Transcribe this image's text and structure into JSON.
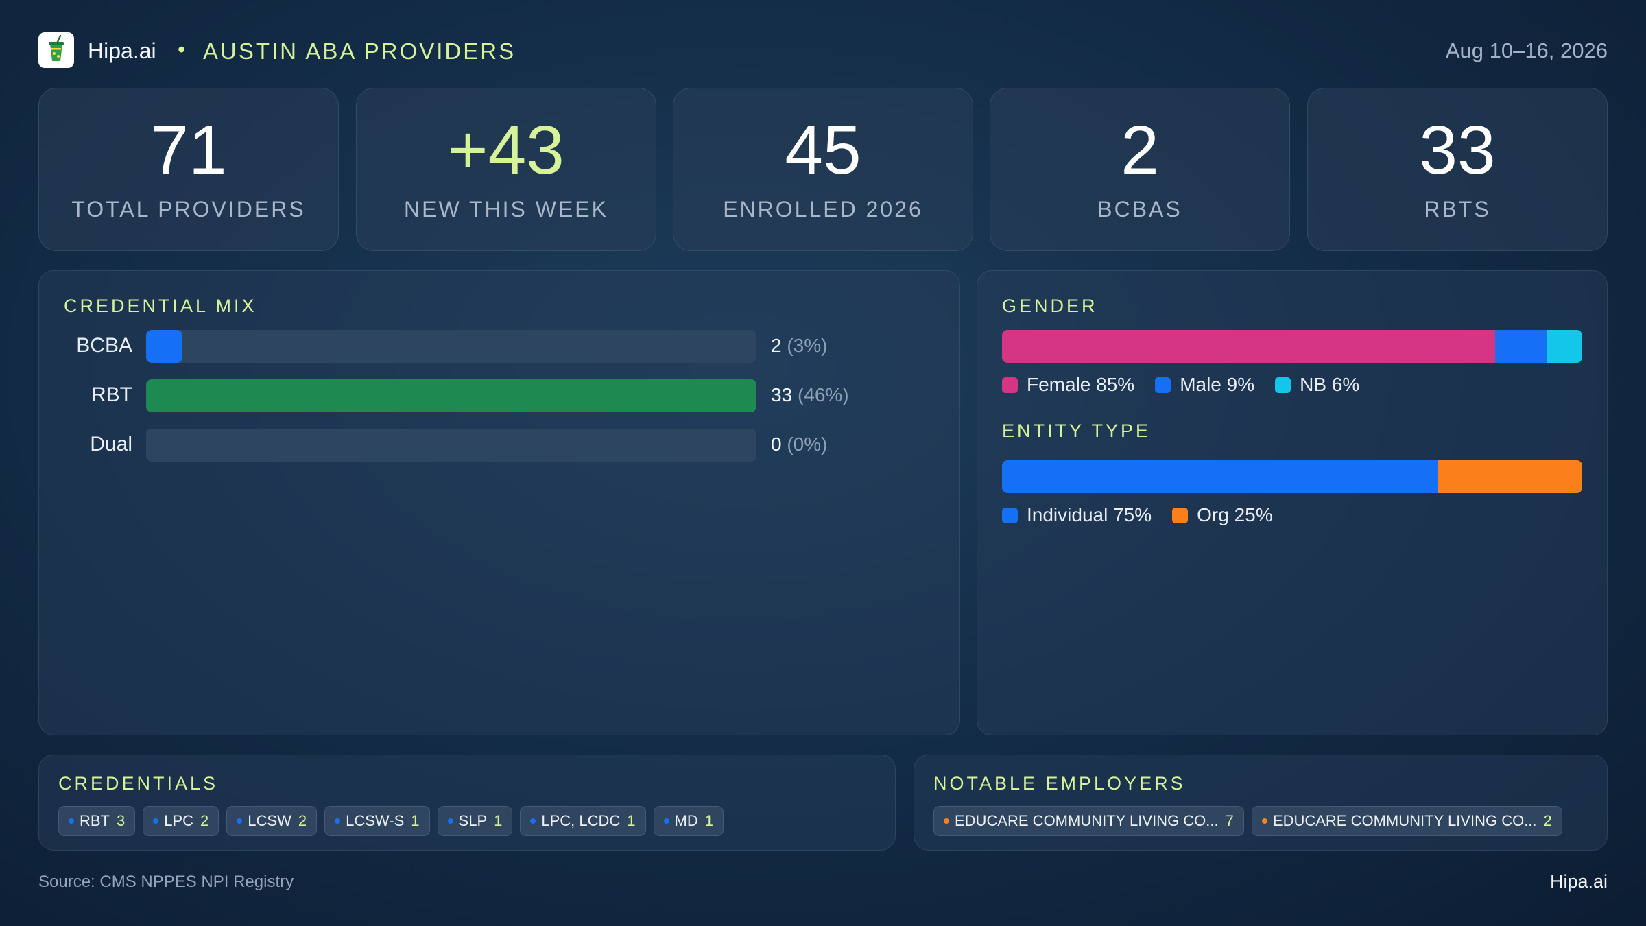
{
  "header": {
    "brand": "Hipa.ai",
    "separator": "•",
    "title": "AUSTIN ABA PROVIDERS",
    "date_range": "Aug 10–16, 2026",
    "logo_icon": "drink-cup-icon"
  },
  "stats": [
    {
      "value": "71",
      "label": "TOTAL PROVIDERS"
    },
    {
      "value": "+43",
      "label": "NEW THIS WEEK"
    },
    {
      "value": "45",
      "label": "ENROLLED 2026"
    },
    {
      "value": "2",
      "label": "BCBAS"
    },
    {
      "value": "33",
      "label": "RBTS"
    }
  ],
  "credential_mix": {
    "title": "CREDENTIAL MIX",
    "rows": [
      {
        "label": "BCBA",
        "count": "2",
        "pct": "(3%)",
        "fraction": 0.06,
        "color": "#1670f5"
      },
      {
        "label": "RBT",
        "count": "33",
        "pct": "(46%)",
        "fraction": 1.0,
        "color": "#1e8a52"
      },
      {
        "label": "Dual",
        "count": "0",
        "pct": "(0%)",
        "fraction": 0.0,
        "color": "#1670f5"
      }
    ]
  },
  "gender": {
    "title": "GENDER",
    "segments": [
      {
        "label": "Female 85%",
        "percent": 85,
        "color": "#d63584"
      },
      {
        "label": "Male 9%",
        "percent": 9,
        "color": "#1670f5"
      },
      {
        "label": "NB 6%",
        "percent": 6,
        "color": "#13c6ea"
      }
    ]
  },
  "entity_type": {
    "title": "ENTITY TYPE",
    "segments": [
      {
        "label": "Individual 75%",
        "percent": 75,
        "color": "#1670f5"
      },
      {
        "label": "Org 25%",
        "percent": 25,
        "color": "#fb801c"
      }
    ]
  },
  "credentials": {
    "title": "CREDENTIALS",
    "dot_color": "#1670f5",
    "items": [
      {
        "name": "RBT",
        "count": "3"
      },
      {
        "name": "LPC",
        "count": "2"
      },
      {
        "name": "LCSW",
        "count": "2"
      },
      {
        "name": "LCSW-S",
        "count": "1"
      },
      {
        "name": "SLP",
        "count": "1"
      },
      {
        "name": "LPC, LCDC",
        "count": "1"
      },
      {
        "name": "MD",
        "count": "1"
      }
    ]
  },
  "employers": {
    "title": "NOTABLE EMPLOYERS",
    "dot_color": "#fb801c",
    "items": [
      {
        "name": "EDUCARE COMMUNITY LIVING CO...",
        "count": "7"
      },
      {
        "name": "EDUCARE COMMUNITY LIVING CO...",
        "count": "2"
      }
    ]
  },
  "footer": {
    "source": "Source: CMS NPPES NPI Registry",
    "brand": "Hipa.ai"
  }
}
